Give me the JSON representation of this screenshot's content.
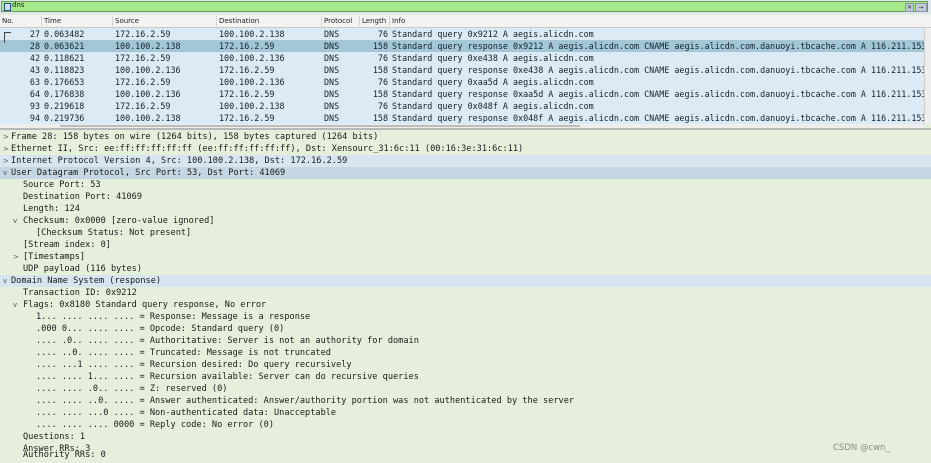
{
  "filter": {
    "value": "dns",
    "clear_label": "✕",
    "apply_label": "→"
  },
  "columns": {
    "no": "No.",
    "time": "Time",
    "source": "Source",
    "destination": "Destination",
    "protocol": "Protocol",
    "length": "Length",
    "info": "Info"
  },
  "packets": [
    {
      "no": "27",
      "time": "0.063482",
      "source": "172.16.2.59",
      "destination": "100.100.2.138",
      "protocol": "DNS",
      "length": "76",
      "info": "Standard query 0x9212 A aegis.alicdn.com"
    },
    {
      "no": "28",
      "time": "0.063621",
      "source": "100.100.2.138",
      "destination": "172.16.2.59",
      "protocol": "DNS",
      "length": "158",
      "info": "Standard query response 0x9212 A aegis.alicdn.com CNAME aegis.alicdn.com.danuoyi.tbcache.com A 116.211.153."
    },
    {
      "no": "42",
      "time": "0.118621",
      "source": "172.16.2.59",
      "destination": "100.100.2.136",
      "protocol": "DNS",
      "length": "76",
      "info": "Standard query 0xe438 A aegis.alicdn.com"
    },
    {
      "no": "43",
      "time": "0.118823",
      "source": "100.100.2.136",
      "destination": "172.16.2.59",
      "protocol": "DNS",
      "length": "158",
      "info": "Standard query response 0xe438 A aegis.alicdn.com CNAME aegis.alicdn.com.danuoyi.tbcache.com A 116.211.153."
    },
    {
      "no": "63",
      "time": "0.176653",
      "source": "172.16.2.59",
      "destination": "100.100.2.136",
      "protocol": "DNS",
      "length": "76",
      "info": "Standard query 0xaa5d A aegis.alicdn.com"
    },
    {
      "no": "64",
      "time": "0.176838",
      "source": "100.100.2.136",
      "destination": "172.16.2.59",
      "protocol": "DNS",
      "length": "158",
      "info": "Standard query response 0xaa5d A aegis.alicdn.com CNAME aegis.alicdn.com.danuoyi.tbcache.com A 116.211.153."
    },
    {
      "no": "93",
      "time": "0.219618",
      "source": "172.16.2.59",
      "destination": "100.100.2.138",
      "protocol": "DNS",
      "length": "76",
      "info": "Standard query 0x048f A aegis.alicdn.com"
    },
    {
      "no": "94",
      "time": "0.219736",
      "source": "100.100.2.138",
      "destination": "172.16.2.59",
      "protocol": "DNS",
      "length": "158",
      "info": "Standard query response 0x048f A aegis.alicdn.com CNAME aegis.alicdn.com.danuoyi.tbcache.com A 116.211.153."
    }
  ],
  "details": [
    {
      "toggle": ">",
      "text": "Frame 28: 158 bytes on wire (1264 bits), 158 bytes captured (1264 bits)"
    },
    {
      "toggle": ">",
      "text": "Ethernet II, Src: ee:ff:ff:ff:ff:ff (ee:ff:ff:ff:ff:ff), Dst: Xensourc_31:6c:11 (00:16:3e:31:6c:11)"
    },
    {
      "toggle": ">",
      "text": "Internet Protocol Version 4, Src: 100.100.2.138, Dst: 172.16.2.59"
    },
    {
      "toggle": "v",
      "text": "User Datagram Protocol, Src Port: 53, Dst Port: 41069"
    },
    {
      "toggle": "",
      "text": "Source Port: 53"
    },
    {
      "toggle": "",
      "text": "Destination Port: 41069"
    },
    {
      "toggle": "",
      "text": "Length: 124"
    },
    {
      "toggle": "v",
      "text": "Checksum: 0x0000 [zero-value ignored]"
    },
    {
      "toggle": "",
      "text": "[Checksum Status: Not present]"
    },
    {
      "toggle": "",
      "text": "[Stream index: 0]"
    },
    {
      "toggle": ">",
      "text": "[Timestamps]"
    },
    {
      "toggle": "",
      "text": "UDP payload (116 bytes)"
    },
    {
      "toggle": "v",
      "text": "Domain Name System (response)"
    },
    {
      "toggle": "",
      "text": "Transaction ID: 0x9212"
    },
    {
      "toggle": "v",
      "text": "Flags: 0x8180 Standard query response, No error"
    },
    {
      "toggle": "",
      "text": "1... .... .... .... = Response: Message is a response"
    },
    {
      "toggle": "",
      "text": ".000 0... .... .... = Opcode: Standard query (0)"
    },
    {
      "toggle": "",
      "text": ".... .0.. .... .... = Authoritative: Server is not an authority for domain"
    },
    {
      "toggle": "",
      "text": ".... ..0. .... .... = Truncated: Message is not truncated"
    },
    {
      "toggle": "",
      "text": ".... ...1 .... .... = Recursion desired: Do query recursively"
    },
    {
      "toggle": "",
      "text": ".... .... 1... .... = Recursion available: Server can do recursive queries"
    },
    {
      "toggle": "",
      "text": ".... .... .0.. .... = Z: reserved (0)"
    },
    {
      "toggle": "",
      "text": ".... .... ..0. .... = Answer authenticated: Answer/authority portion was not authenticated by the server"
    },
    {
      "toggle": "",
      "text": ".... .... ...0 .... = Non-authenticated data: Unacceptable"
    },
    {
      "toggle": "",
      "text": ".... .... .... 0000 = Reply code: No error (0)"
    },
    {
      "toggle": "",
      "text": "Questions: 1"
    },
    {
      "toggle": "",
      "text": "Answer RRs: 3"
    },
    {
      "toggle": "",
      "text": "Authority RRs: 0"
    }
  ],
  "watermark": "CSDN @cwn_"
}
